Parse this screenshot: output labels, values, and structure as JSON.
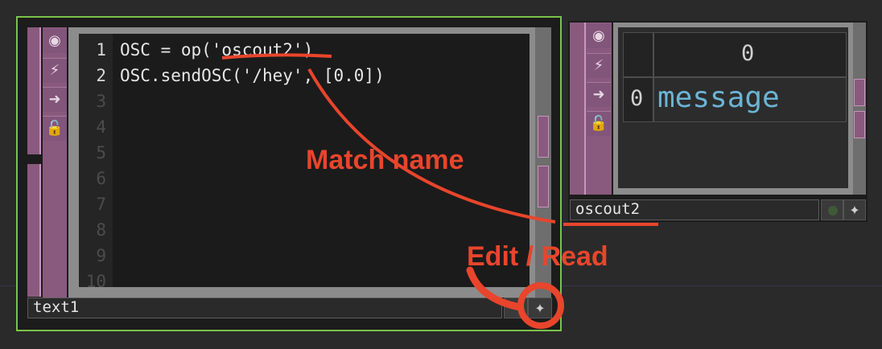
{
  "nodes": {
    "text1": {
      "name": "text1",
      "line_numbers": [
        "1",
        "2",
        "3",
        "4",
        "5",
        "6",
        "7",
        "8",
        "9",
        "10"
      ],
      "code_lines": [
        "OSC = op('oscout2')",
        "OSC.sendOSC('/hey', [0.0])"
      ],
      "side_icons": [
        "viewer-icon",
        "cook-icon",
        "export-icon",
        "lock-icon"
      ]
    },
    "oscout2": {
      "name": "oscout2",
      "table": {
        "column_headers": [
          "0"
        ],
        "row_headers": [
          "0"
        ],
        "cells": [
          [
            "message"
          ]
        ]
      },
      "side_icons": [
        "viewer-icon",
        "cook-icon",
        "export-icon",
        "lock-icon"
      ]
    }
  },
  "annotations": {
    "match_name": "Match name",
    "edit_read": "Edit / Read"
  },
  "colors": {
    "annotation": "#e8452c",
    "selected_outline": "#7cc24a",
    "operator_strip": "#8a5a7e",
    "cell_text": "#6cb4d4"
  }
}
